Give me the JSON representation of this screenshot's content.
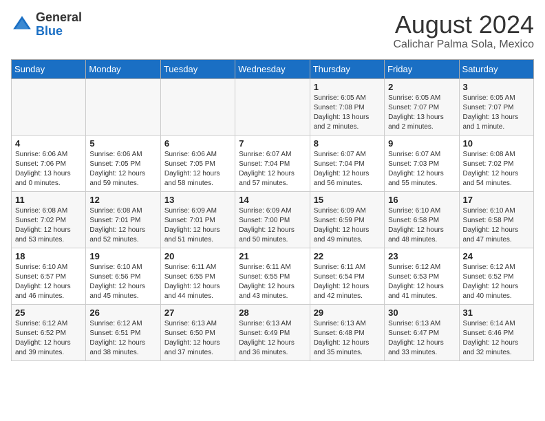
{
  "header": {
    "logo_general": "General",
    "logo_blue": "Blue",
    "month_title": "August 2024",
    "location": "Calichar Palma Sola, Mexico"
  },
  "days_of_week": [
    "Sunday",
    "Monday",
    "Tuesday",
    "Wednesday",
    "Thursday",
    "Friday",
    "Saturday"
  ],
  "weeks": [
    [
      {
        "day": "",
        "info": ""
      },
      {
        "day": "",
        "info": ""
      },
      {
        "day": "",
        "info": ""
      },
      {
        "day": "",
        "info": ""
      },
      {
        "day": "1",
        "info": "Sunrise: 6:05 AM\nSunset: 7:08 PM\nDaylight: 13 hours\nand 2 minutes."
      },
      {
        "day": "2",
        "info": "Sunrise: 6:05 AM\nSunset: 7:07 PM\nDaylight: 13 hours\nand 2 minutes."
      },
      {
        "day": "3",
        "info": "Sunrise: 6:05 AM\nSunset: 7:07 PM\nDaylight: 13 hours\nand 1 minute."
      }
    ],
    [
      {
        "day": "4",
        "info": "Sunrise: 6:06 AM\nSunset: 7:06 PM\nDaylight: 13 hours\nand 0 minutes."
      },
      {
        "day": "5",
        "info": "Sunrise: 6:06 AM\nSunset: 7:05 PM\nDaylight: 12 hours\nand 59 minutes."
      },
      {
        "day": "6",
        "info": "Sunrise: 6:06 AM\nSunset: 7:05 PM\nDaylight: 12 hours\nand 58 minutes."
      },
      {
        "day": "7",
        "info": "Sunrise: 6:07 AM\nSunset: 7:04 PM\nDaylight: 12 hours\nand 57 minutes."
      },
      {
        "day": "8",
        "info": "Sunrise: 6:07 AM\nSunset: 7:04 PM\nDaylight: 12 hours\nand 56 minutes."
      },
      {
        "day": "9",
        "info": "Sunrise: 6:07 AM\nSunset: 7:03 PM\nDaylight: 12 hours\nand 55 minutes."
      },
      {
        "day": "10",
        "info": "Sunrise: 6:08 AM\nSunset: 7:02 PM\nDaylight: 12 hours\nand 54 minutes."
      }
    ],
    [
      {
        "day": "11",
        "info": "Sunrise: 6:08 AM\nSunset: 7:02 PM\nDaylight: 12 hours\nand 53 minutes."
      },
      {
        "day": "12",
        "info": "Sunrise: 6:08 AM\nSunset: 7:01 PM\nDaylight: 12 hours\nand 52 minutes."
      },
      {
        "day": "13",
        "info": "Sunrise: 6:09 AM\nSunset: 7:01 PM\nDaylight: 12 hours\nand 51 minutes."
      },
      {
        "day": "14",
        "info": "Sunrise: 6:09 AM\nSunset: 7:00 PM\nDaylight: 12 hours\nand 50 minutes."
      },
      {
        "day": "15",
        "info": "Sunrise: 6:09 AM\nSunset: 6:59 PM\nDaylight: 12 hours\nand 49 minutes."
      },
      {
        "day": "16",
        "info": "Sunrise: 6:10 AM\nSunset: 6:58 PM\nDaylight: 12 hours\nand 48 minutes."
      },
      {
        "day": "17",
        "info": "Sunrise: 6:10 AM\nSunset: 6:58 PM\nDaylight: 12 hours\nand 47 minutes."
      }
    ],
    [
      {
        "day": "18",
        "info": "Sunrise: 6:10 AM\nSunset: 6:57 PM\nDaylight: 12 hours\nand 46 minutes."
      },
      {
        "day": "19",
        "info": "Sunrise: 6:10 AM\nSunset: 6:56 PM\nDaylight: 12 hours\nand 45 minutes."
      },
      {
        "day": "20",
        "info": "Sunrise: 6:11 AM\nSunset: 6:55 PM\nDaylight: 12 hours\nand 44 minutes."
      },
      {
        "day": "21",
        "info": "Sunrise: 6:11 AM\nSunset: 6:55 PM\nDaylight: 12 hours\nand 43 minutes."
      },
      {
        "day": "22",
        "info": "Sunrise: 6:11 AM\nSunset: 6:54 PM\nDaylight: 12 hours\nand 42 minutes."
      },
      {
        "day": "23",
        "info": "Sunrise: 6:12 AM\nSunset: 6:53 PM\nDaylight: 12 hours\nand 41 minutes."
      },
      {
        "day": "24",
        "info": "Sunrise: 6:12 AM\nSunset: 6:52 PM\nDaylight: 12 hours\nand 40 minutes."
      }
    ],
    [
      {
        "day": "25",
        "info": "Sunrise: 6:12 AM\nSunset: 6:52 PM\nDaylight: 12 hours\nand 39 minutes."
      },
      {
        "day": "26",
        "info": "Sunrise: 6:12 AM\nSunset: 6:51 PM\nDaylight: 12 hours\nand 38 minutes."
      },
      {
        "day": "27",
        "info": "Sunrise: 6:13 AM\nSunset: 6:50 PM\nDaylight: 12 hours\nand 37 minutes."
      },
      {
        "day": "28",
        "info": "Sunrise: 6:13 AM\nSunset: 6:49 PM\nDaylight: 12 hours\nand 36 minutes."
      },
      {
        "day": "29",
        "info": "Sunrise: 6:13 AM\nSunset: 6:48 PM\nDaylight: 12 hours\nand 35 minutes."
      },
      {
        "day": "30",
        "info": "Sunrise: 6:13 AM\nSunset: 6:47 PM\nDaylight: 12 hours\nand 33 minutes."
      },
      {
        "day": "31",
        "info": "Sunrise: 6:14 AM\nSunset: 6:46 PM\nDaylight: 12 hours\nand 32 minutes."
      }
    ]
  ]
}
